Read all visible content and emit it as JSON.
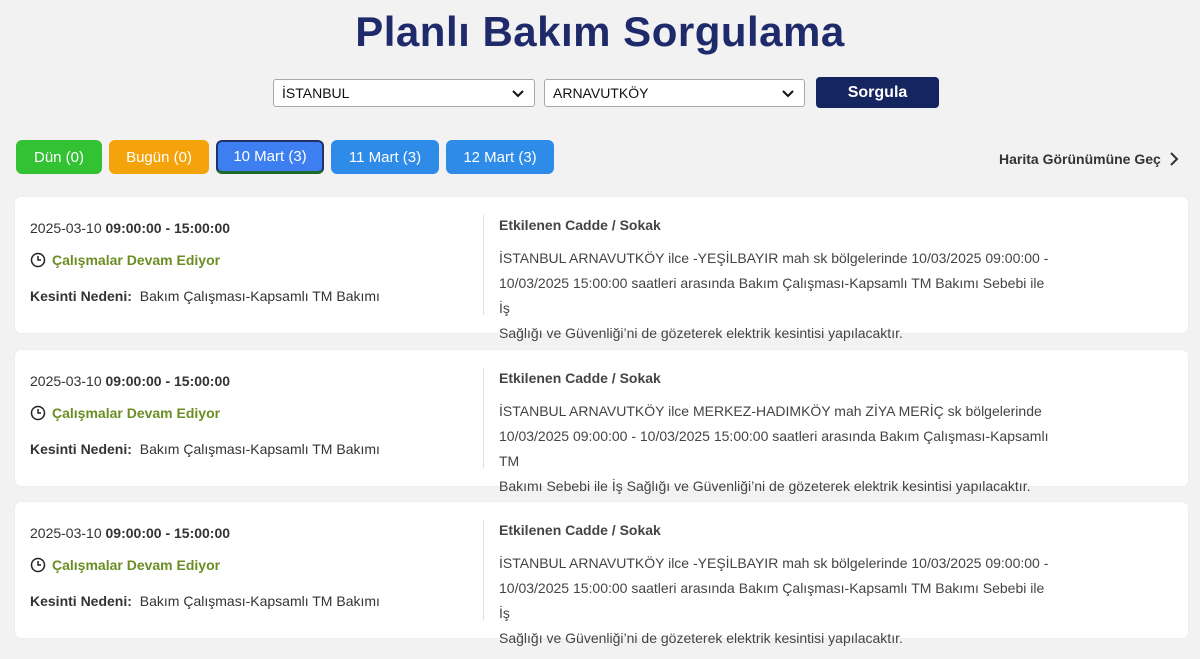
{
  "page": {
    "title": "Planlı Bakım Sorgulama"
  },
  "filters": {
    "city": "İSTANBUL",
    "district": "ARNAVUTKÖY",
    "query_button": "Sorgula"
  },
  "tabs": [
    {
      "label": "Dün (0)",
      "color": "#33c233"
    },
    {
      "label": "Bugün (0)",
      "color": "#f5a30a"
    },
    {
      "label": "10 Mart (3)",
      "color": "#3d7ef0",
      "active": true
    },
    {
      "label": "11 Mart (3)",
      "color": "#2f8be8"
    },
    {
      "label": "12 Mart (3)",
      "color": "#2f8be8"
    }
  ],
  "map_link": "Harita Görünümüne Geç",
  "cards": [
    {
      "date": "2025-03-10",
      "time": "09:00:00 - 15:00:00",
      "status": "Çalışmalar Devam Ediyor",
      "reason_label": "Kesinti Nedeni:",
      "reason": "Bakım Çalışması-Kapsamlı TM Bakımı",
      "affected_title": "Etkilenen Cadde / Sokak",
      "lines": [
        "İSTANBUL ARNAVUTKÖY ilce -YEŞİLBAYIR mah sk bölgelerinde 10/03/2025 09:00:00 -",
        "10/03/2025 15:00:00 saatleri arasında Bakım Çalışması-Kapsamlı TM Bakımı Sebebi ile İş",
        "Sağlığı ve Güvenliği’ni de gözeterek elektrik kesintisi yapılacaktır."
      ]
    },
    {
      "date": "2025-03-10",
      "time": "09:00:00 - 15:00:00",
      "status": "Çalışmalar Devam Ediyor",
      "reason_label": "Kesinti Nedeni:",
      "reason": "Bakım Çalışması-Kapsamlı TM Bakımı",
      "affected_title": "Etkilenen Cadde / Sokak",
      "lines": [
        "İSTANBUL ARNAVUTKÖY ilce MERKEZ-HADIMKÖY mah ZİYA MERİÇ sk bölgelerinde",
        "10/03/2025 09:00:00 - 10/03/2025 15:00:00 saatleri arasında Bakım Çalışması-Kapsamlı TM",
        "Bakımı Sebebi ile İş Sağlığı ve Güvenliği’ni de gözeterek elektrik kesintisi yapılacaktır."
      ]
    },
    {
      "date": "2025-03-10",
      "time": "09:00:00 - 15:00:00",
      "status": "Çalışmalar Devam Ediyor",
      "reason_label": "Kesinti Nedeni:",
      "reason": "Bakım Çalışması-Kapsamlı TM Bakımı",
      "affected_title": "Etkilenen Cadde / Sokak",
      "lines": [
        "İSTANBUL ARNAVUTKÖY ilce -YEŞİLBAYIR mah sk bölgelerinde 10/03/2025 09:00:00 -",
        "10/03/2025 15:00:00 saatleri arasında Bakım Çalışması-Kapsamlı TM Bakımı Sebebi ile İş",
        "Sağlığı ve Güvenliği’ni de gözeterek elektrik kesintisi yapılacaktır."
      ]
    }
  ],
  "colors": {
    "brand": "#1f2a6b",
    "button": "#14255f",
    "status": "#6b8e23"
  }
}
